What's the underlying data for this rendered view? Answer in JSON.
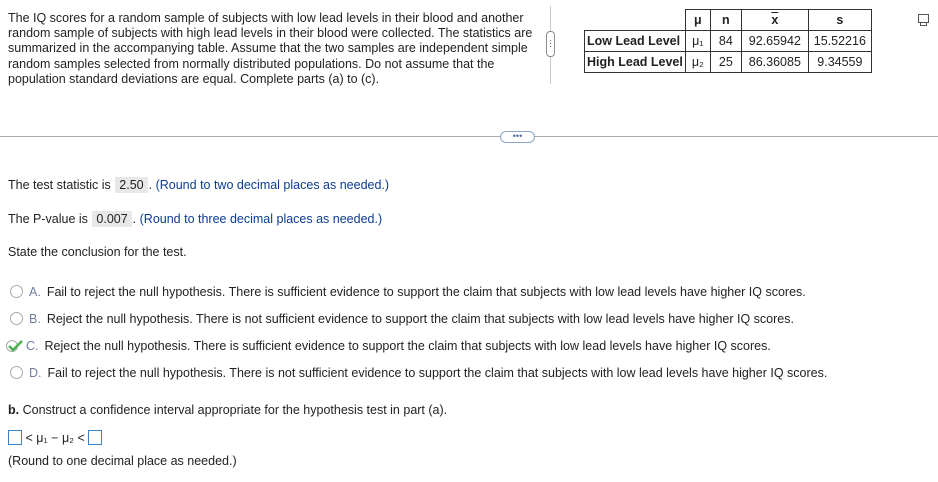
{
  "problem_text": "The IQ scores for a random sample of subjects with low lead levels in their blood and another random sample of subjects with high lead levels in their blood were collected. The statistics are summarized in the accompanying table. Assume that the two samples are independent simple random samples selected from normally distributed populations. Do not assume that the population standard deviations are equal. Complete parts (a) to (c).",
  "table": {
    "headers": {
      "mu": "μ",
      "n": "n",
      "xbar": "x",
      "s": "s"
    },
    "rows": [
      {
        "label": "Low Lead Level",
        "mu": "μ₁",
        "n": "84",
        "xbar": "92.65942",
        "s": "15.52216"
      },
      {
        "label": "High Lead Level",
        "mu": "μ₂",
        "n": "25",
        "xbar": "86.36085",
        "s": "9.34559"
      }
    ]
  },
  "more_button": "•••",
  "test_statistic": {
    "prefix": "The test statistic is",
    "value": "2.50",
    "hint": "(Round to two decimal places as needed.)"
  },
  "p_value": {
    "prefix": "The P-value is",
    "value": "0.007",
    "hint": "(Round to three decimal places as needed.)"
  },
  "conclusion_prompt": "State the conclusion for the test.",
  "options": [
    {
      "letter": "A.",
      "text": "Fail to reject the null hypothesis. There is sufficient evidence to support the claim that subjects with low lead levels have higher IQ scores.",
      "selected": false
    },
    {
      "letter": "B.",
      "text": "Reject the null hypothesis. There is not sufficient evidence to support the claim that subjects with low lead levels have higher IQ scores.",
      "selected": false
    },
    {
      "letter": "C.",
      "text": "Reject the null hypothesis. There is sufficient evidence to support the claim that subjects with low lead levels have higher IQ scores.",
      "selected": true
    },
    {
      "letter": "D.",
      "text": "Fail to reject the null hypothesis. There is not sufficient evidence to support the claim that subjects with low lead levels have higher IQ scores.",
      "selected": false
    }
  ],
  "part_b": {
    "label": "b.",
    "text": "Construct a confidence interval appropriate for the hypothesis test in part (a).",
    "interval_left_sign": "<",
    "interval_middle": "μ₁ − μ₂",
    "interval_right_sign": "<",
    "lower_value": "",
    "upper_value": "",
    "hint": "(Round to one decimal place as needed.)"
  },
  "colors": {
    "accent": "#0b3d91",
    "check": "#4caf50",
    "input_border": "#3d84c4"
  }
}
